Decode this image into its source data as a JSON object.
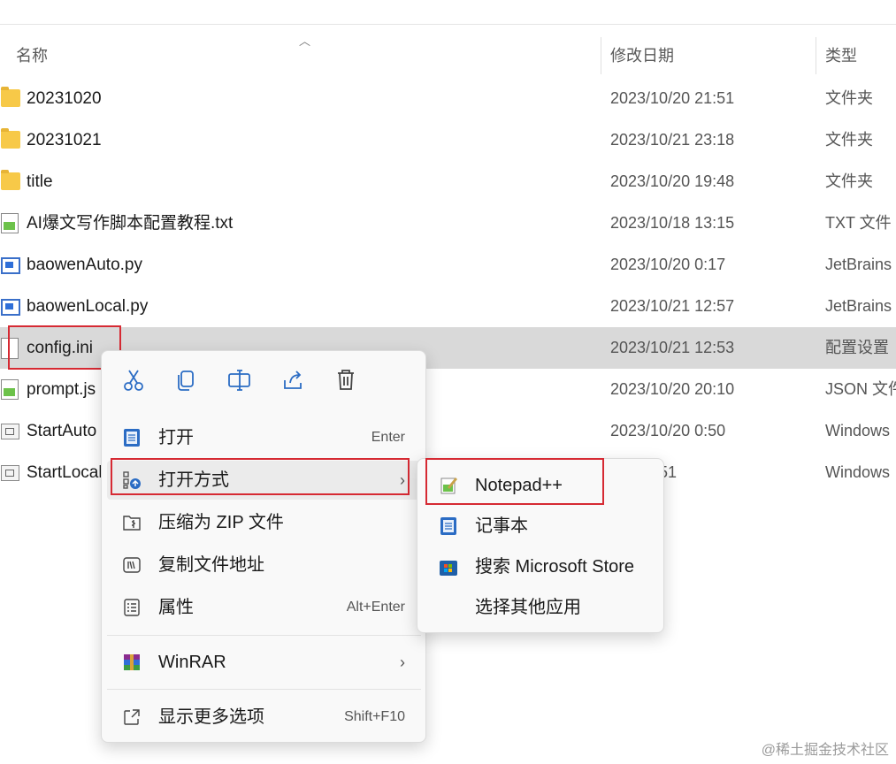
{
  "columns": {
    "name": "名称",
    "modified": "修改日期",
    "type": "类型"
  },
  "files": [
    {
      "name": "20231020",
      "date": "2023/10/20 21:51",
      "type": "文件夹",
      "icon": "folder-icon"
    },
    {
      "name": "20231021",
      "date": "2023/10/21 23:18",
      "type": "文件夹",
      "icon": "folder-icon"
    },
    {
      "name": "title",
      "date": "2023/10/20 19:48",
      "type": "文件夹",
      "icon": "folder-icon"
    },
    {
      "name": "AI爆文写作脚本配置教程.txt",
      "date": "2023/10/18 13:15",
      "type": "TXT 文件",
      "icon": "notepadpp-file-icon"
    },
    {
      "name": "baowenAuto.py",
      "date": "2023/10/20 0:17",
      "type": "JetBrains",
      "icon": "pycharm-file-icon"
    },
    {
      "name": "baowenLocal.py",
      "date": "2023/10/21 12:57",
      "type": "JetBrains",
      "icon": "pycharm-file-icon"
    },
    {
      "name": "config.ini",
      "date": "2023/10/21 12:53",
      "type": "配置设置",
      "icon": "ini-file-icon",
      "selected": true
    },
    {
      "name": "prompt.js",
      "date": "2023/10/20 20:10",
      "type": "JSON 文件",
      "icon": "notepadpp-file-icon"
    },
    {
      "name": "StartAuto",
      "date": "2023/10/20 0:50",
      "type": "Windows",
      "icon": "batch-file-icon"
    },
    {
      "name": "StartLocal",
      "date": "0/20 0:51",
      "type": "Windows",
      "icon": "batch-file-icon"
    }
  ],
  "context_menu": {
    "quick_actions": [
      "cut-icon",
      "copy-icon",
      "rename-icon",
      "share-icon",
      "delete-icon"
    ],
    "items": [
      {
        "label": "打开",
        "shortcut": "Enter",
        "icon": "notepad-icon"
      },
      {
        "label": "打开方式",
        "shortcut": "",
        "icon": "open-with-icon",
        "arrow": "›"
      },
      {
        "label": "压缩为 ZIP 文件",
        "shortcut": "",
        "icon": "zip-icon"
      },
      {
        "label": "复制文件地址",
        "shortcut": "",
        "icon": "copy-path-icon"
      },
      {
        "label": "属性",
        "shortcut": "Alt+Enter",
        "icon": "properties-icon"
      },
      {
        "label": "WinRAR",
        "shortcut": "",
        "icon": "winrar-icon",
        "arrow": "›"
      },
      {
        "label": "显示更多选项",
        "shortcut": "Shift+F10",
        "icon": "more-options-icon"
      }
    ]
  },
  "submenu": {
    "items": [
      {
        "label": "Notepad++",
        "icon": "notepadpp-icon"
      },
      {
        "label": "记事本",
        "icon": "notepad-icon"
      },
      {
        "label": "搜索 Microsoft Store",
        "icon": "microsoft-store-icon"
      },
      {
        "label": "选择其他应用",
        "icon": ""
      }
    ]
  },
  "watermark": "@稀土掘金技术社区",
  "colors": {
    "highlight_box": "#d62a33",
    "selection": "#d9d9d9",
    "folder": "#f7c948"
  }
}
